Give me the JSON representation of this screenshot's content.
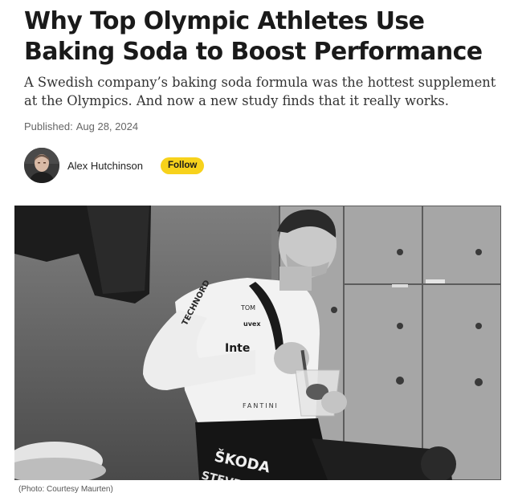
{
  "article": {
    "headline": "Why Top Olympic Athletes Use Baking Soda to Boost Performance",
    "dek": "A Swedish company’s baking soda formula was the hottest supplement at the Olympics. And now a new study finds that it really works.",
    "published_label": "Published:",
    "published_date": "Aug 28, 2024"
  },
  "author": {
    "name": "Alex Hutchinson",
    "follow_label": "Follow"
  },
  "hero_image": {
    "caption": "(Photo: Courtesy Maurten)",
    "jersey_text": {
      "brand_top": "TECHNORD",
      "name": "TOM",
      "sponsor_1": "uvex",
      "sponsor_2": "Inte",
      "sponsor_3": "FANTINI",
      "shorts_1": "ŠKODA",
      "shorts_2": "STEVEN"
    }
  },
  "colors": {
    "follow_button": "#f7d21c",
    "headline": "#1a1a1a",
    "dek": "#333333",
    "meta": "#666666"
  }
}
